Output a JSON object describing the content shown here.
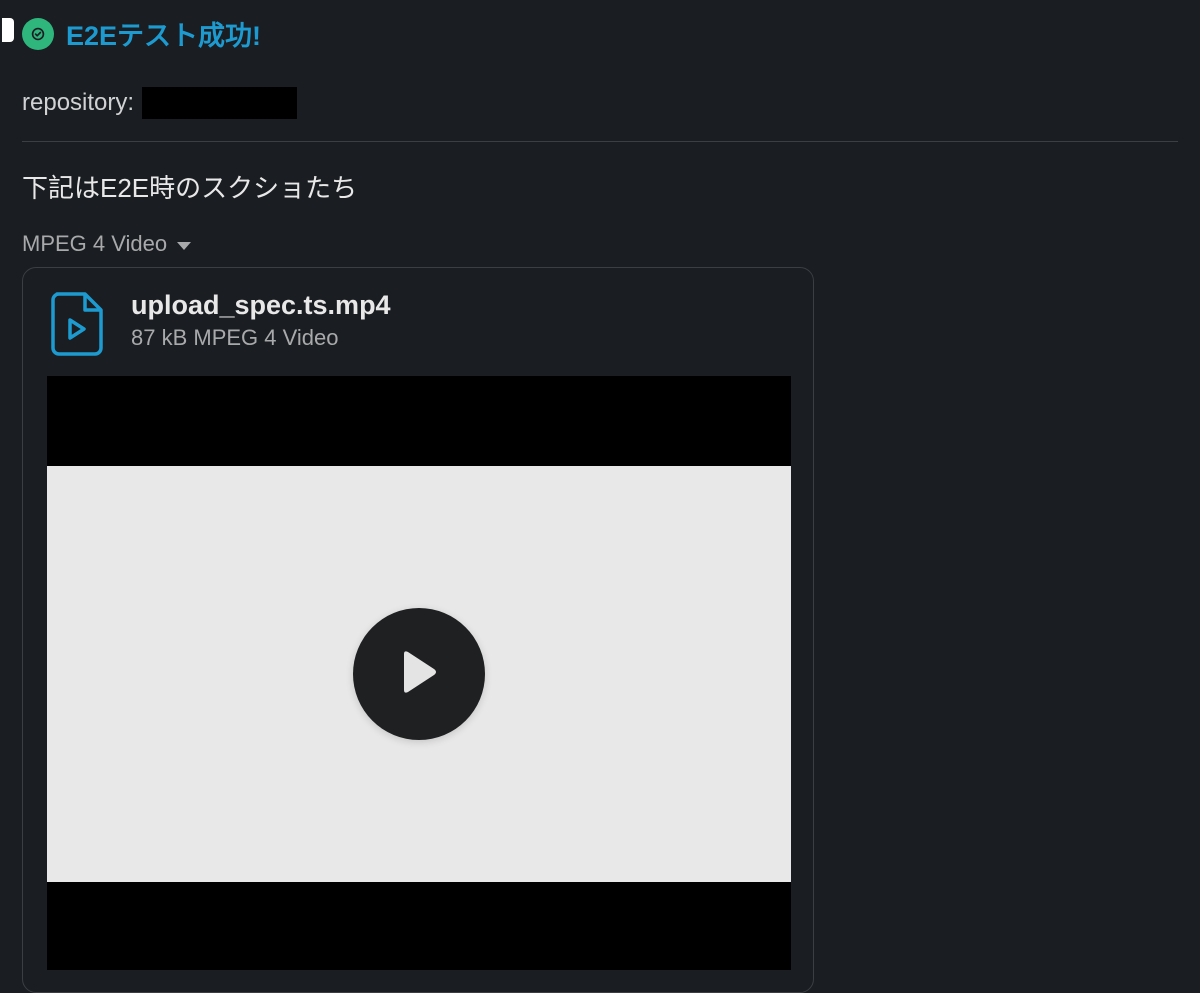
{
  "status": {
    "title": "E2Eテスト成功!"
  },
  "repository": {
    "label": "repository:"
  },
  "section": {
    "title": "下記はE2E時のスクショたち"
  },
  "file_group": {
    "type_label": "MPEG 4 Video"
  },
  "attachment": {
    "file_name": "upload_spec.ts.mp4",
    "meta": "87 kB MPEG 4 Video"
  }
}
